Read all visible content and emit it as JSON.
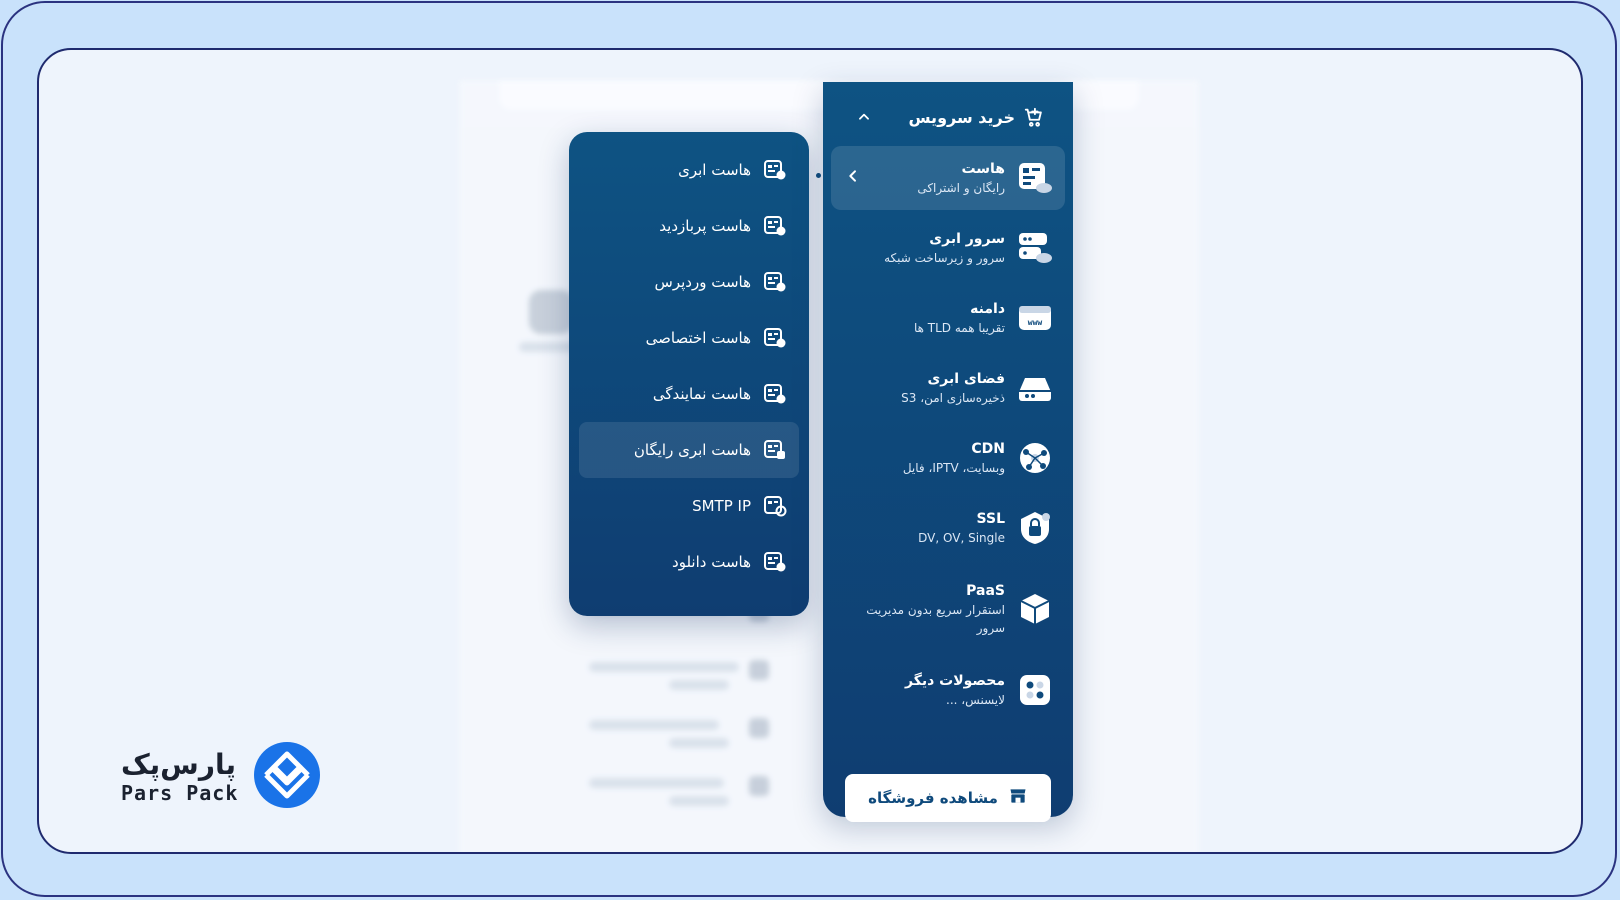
{
  "main_menu": {
    "title": "خرید سرویس",
    "items": [
      {
        "title": "هاست",
        "subtitle": "رایگان و اشتراکی",
        "icon": "host-cloud-icon"
      },
      {
        "title": "سرور ابری",
        "subtitle": "سرور و زیرساخت شبکه",
        "icon": "cloud-server-icon"
      },
      {
        "title": "دامنه",
        "subtitle": "تقریبا همه TLD ها",
        "icon": "domain-www-icon"
      },
      {
        "title": "فضای ابری",
        "subtitle": "ذخیره‌سازی امن، S3",
        "icon": "cloud-storage-icon"
      },
      {
        "title": "CDN",
        "subtitle": "وبسایت، IPTV، فایل",
        "icon": "cdn-globe-icon"
      },
      {
        "title": "SSL",
        "subtitle": "DV, OV, Single",
        "icon": "ssl-lock-icon"
      },
      {
        "title": "PaaS",
        "subtitle": "استقرار سریع بدون مدیریت سرور",
        "icon": "paas-cube-icon"
      },
      {
        "title": "محصولات دیگر",
        "subtitle": "لایسنس، ...",
        "icon": "other-products-icon"
      }
    ],
    "shop_button": "مشاهده فروشگاه"
  },
  "sub_menu": {
    "items": [
      {
        "label": "هاست ابری"
      },
      {
        "label": "هاست پربازدید"
      },
      {
        "label": "هاست وردپرس"
      },
      {
        "label": "هاست اختصاصی"
      },
      {
        "label": "هاست نمایندگی"
      },
      {
        "label": "هاست ابری رایگان"
      },
      {
        "label": "SMTP IP"
      },
      {
        "label": "هاست دانلود"
      }
    ]
  },
  "logo": {
    "text_fa": "پارس‌پک",
    "text_en": "Pars Pack"
  },
  "colors": {
    "menu_top": "#0e5383",
    "menu_bottom": "#0f3d71",
    "logo_blue": "#1a73e8",
    "page_bg": "#c9e2fb"
  }
}
